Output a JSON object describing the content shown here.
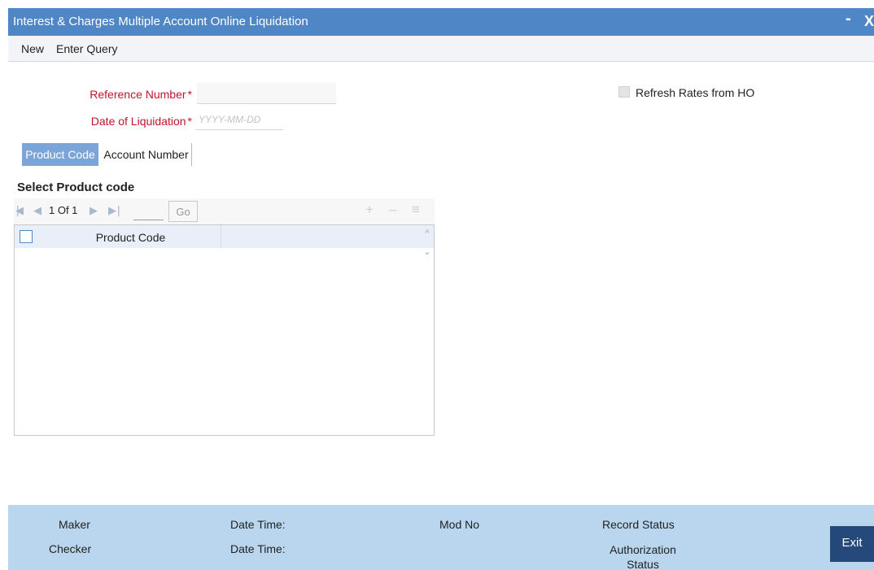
{
  "window": {
    "title": "Interest & Charges Multiple Account Online Liquidation",
    "minimize_glyph": "-",
    "close_glyph": "X"
  },
  "menu": {
    "new_label": "New",
    "enter_query_label": "Enter Query"
  },
  "form": {
    "reference_number": {
      "label": "Reference Number",
      "required_mark": "*",
      "value": ""
    },
    "date_of_liquidation": {
      "label": "Date of Liquidation",
      "required_mark": "*",
      "placeholder": "YYYY-MM-DD",
      "value": ""
    },
    "refresh_rates": {
      "label": "Refresh Rates from HO",
      "checked": false
    }
  },
  "tabs": [
    {
      "label": "Product Code",
      "active": true
    },
    {
      "label": "Account Number",
      "active": false
    }
  ],
  "product_section": {
    "title": "Select Product code",
    "pager": {
      "page_text": "1 Of 1",
      "go_label": "Go",
      "first_icon": "first-page-icon",
      "prev_icon": "prev-page-icon",
      "next_icon": "next-page-icon",
      "last_icon": "last-page-icon",
      "add_icon": "plus-icon",
      "remove_icon": "minus-icon",
      "view_icon": "list-icon"
    },
    "grid": {
      "columns": [
        "Product Code"
      ],
      "rows": []
    }
  },
  "footer": {
    "maker_label": "Maker",
    "checker_label": "Checker",
    "maker_datetime_label": "Date Time:",
    "checker_datetime_label": "Date Time:",
    "mod_no_label": "Mod No",
    "record_status_label": "Record Status",
    "authorization_status_label": "Authorization Status",
    "exit_label": "Exit"
  },
  "colors": {
    "title_bar": "#4e86c6",
    "required_label": "#c0152a",
    "active_tab": "#7ba4d8",
    "footer": "#b9d6ee",
    "exit_button": "#24497a"
  }
}
